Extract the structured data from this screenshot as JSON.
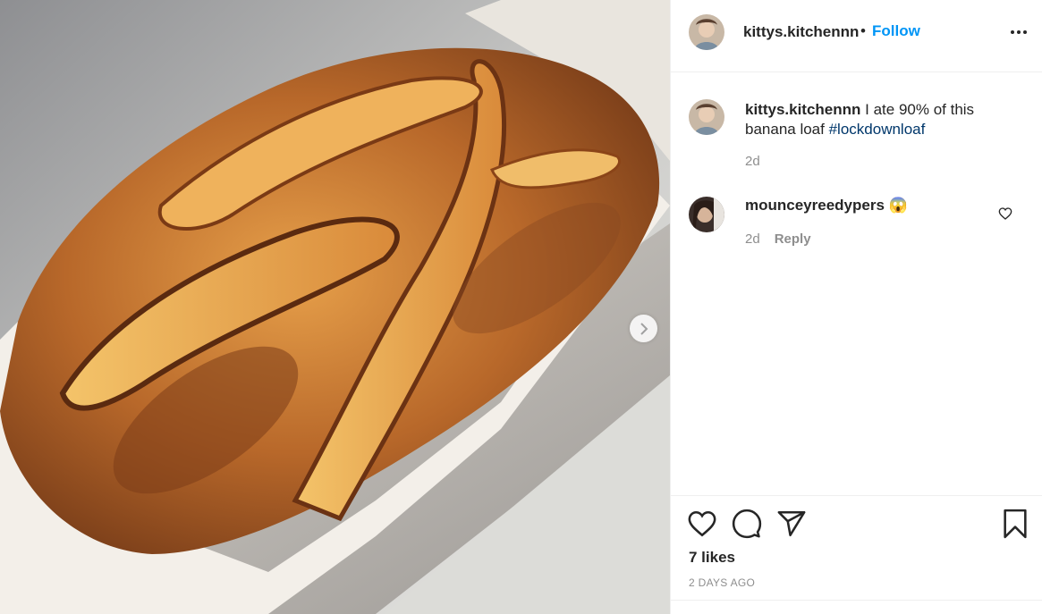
{
  "post": {
    "username": "kittys.kitchennn",
    "separator": "•",
    "follow_label": "Follow",
    "more_icon": "more-options-icon",
    "image_alt": "banana loaf in baking tin"
  },
  "caption": {
    "username": "kittys.kitchennn",
    "text": "I ate 90% of this banana loaf ",
    "hashtag": "#lockdownloaf",
    "time": "2d"
  },
  "comments": [
    {
      "username": "mounceyreedypers",
      "emoji": "😱",
      "time": "2d",
      "reply_label": "Reply"
    }
  ],
  "footer": {
    "likes": "7 likes",
    "posted": "2 DAYS AGO"
  },
  "colors": {
    "accent": "#0095f6",
    "hashtag": "#00376b",
    "muted": "#8e8e8e",
    "border": "#efefef"
  }
}
